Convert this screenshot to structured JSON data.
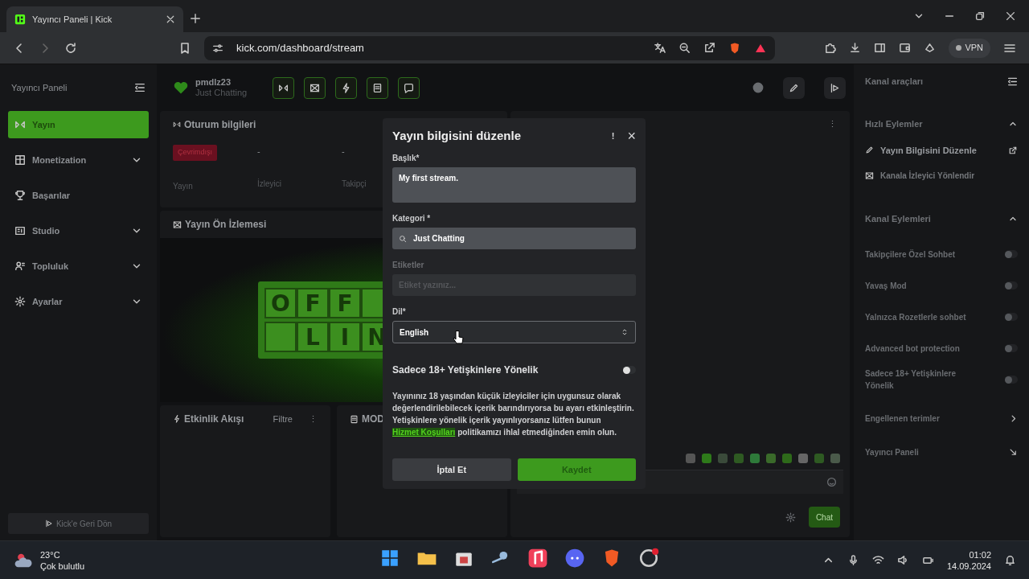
{
  "browser": {
    "tab_title": "Yayıncı Paneli | Kick",
    "url": "kick.com/dashboard/stream",
    "vpn": "VPN"
  },
  "sidebar": {
    "title": "Yayıncı Paneli",
    "items": [
      {
        "label": "Yayın",
        "kind": "stream",
        "selected": true,
        "expandable": false
      },
      {
        "label": "Monetization",
        "kind": "money",
        "selected": false,
        "expandable": true
      },
      {
        "label": "Başarılar",
        "kind": "trophy",
        "selected": false,
        "expandable": false
      },
      {
        "label": "Studio",
        "kind": "studio",
        "selected": false,
        "expandable": true
      },
      {
        "label": "Topluluk",
        "kind": "community",
        "selected": false,
        "expandable": true
      },
      {
        "label": "Ayarlar",
        "kind": "settings",
        "selected": false,
        "expandable": true
      }
    ],
    "back_button": "Kick'e Geri Dön"
  },
  "header": {
    "username": "pmdlz23",
    "category": "Just Chatting",
    "tools": [
      {
        "kind": "stream"
      },
      {
        "kind": "preview"
      },
      {
        "kind": "bolt"
      },
      {
        "kind": "notes"
      },
      {
        "kind": "chat"
      }
    ]
  },
  "session_card": {
    "title": "Oturum bilgileri",
    "stats": [
      {
        "kind": "badge",
        "value": "Çevrimdışı",
        "label": "Yayın"
      },
      {
        "kind": "text",
        "value": "-",
        "label": "İzleyici"
      },
      {
        "kind": "text",
        "value": "-",
        "label": "Takipçi"
      }
    ]
  },
  "preview_card": {
    "title": "Yayın Ön İzlemesi",
    "sign_top": [
      "O",
      "F",
      "F"
    ],
    "sign_bottom": [
      "L",
      "I",
      "N"
    ]
  },
  "activity_card": {
    "title": "Etkinlik Akışı",
    "filter": "Filtre",
    "menu": "⋮"
  },
  "mod_card": {
    "title": "MOD"
  },
  "chat": {
    "menu": "⋮",
    "send": "Chat"
  },
  "right_panel": {
    "title": "Kanal araçları",
    "quick_actions": {
      "title": "Hızlı Eylemler",
      "expanded": true,
      "items": [
        {
          "label": "Yayın Bilgisini Düzenle",
          "disabled": false
        },
        {
          "label": "Kanala İzleyici Yönlendir",
          "disabled": true
        }
      ]
    },
    "channel_actions": {
      "title": "Kanal Eylemleri",
      "expanded": true,
      "toggles": [
        {
          "label": "Takipçilere Özel Sohbet",
          "on": false
        },
        {
          "label": "Yavaş Mod",
          "on": false
        },
        {
          "label": "Yalnızca Rozetlerle sohbet",
          "on": false
        },
        {
          "label": "Advanced bot protection",
          "on": false
        },
        {
          "label": "Sadece 18+ Yetişkinlere Yönelik",
          "on": false
        }
      ]
    },
    "links": [
      {
        "label": "Engellenen terimler",
        "kind": "chevron"
      },
      {
        "label": "Yayıncı Paneli",
        "kind": "external"
      }
    ]
  },
  "modal": {
    "title": "Yayın bilgisini düzenle",
    "info": "!",
    "close": "×",
    "fields": [
      {
        "kind": "textarea",
        "label": "Başlık*",
        "value": "My first stream.",
        "disabled": false
      },
      {
        "kind": "search",
        "label": "Kategori *",
        "value": "Just Chatting",
        "disabled": false
      },
      {
        "kind": "input",
        "label": "Etiketler",
        "placeholder": "Etiket yazınız...",
        "disabled": true
      },
      {
        "kind": "select",
        "label": "Dil*",
        "value": "English",
        "disabled": false
      }
    ],
    "adult": {
      "label": "Sadece 18+ Yetişkinlere Yönelik",
      "on": false
    },
    "notice_before": "Yayınınız 18 yaşından küçük izleyiciler için uygunsuz olarak değerlendirilebilecek içerik barındırıyorsa bu ayarı etkinleştirin. Yetişkinlere yönelik içerik yayınlıyorsanız lütfen bunun",
    "notice_link": "Hizmet Koşulları",
    "notice_after": "politikamızı ihlal etmediğinden emin olun.",
    "cancel": "İptal Et",
    "save": "Kaydet",
    "save_disabled": true
  },
  "taskbar": {
    "temperature": "23°C",
    "weather": "Çok bulutlu",
    "time": "01:02",
    "date": "14.09.2024"
  }
}
